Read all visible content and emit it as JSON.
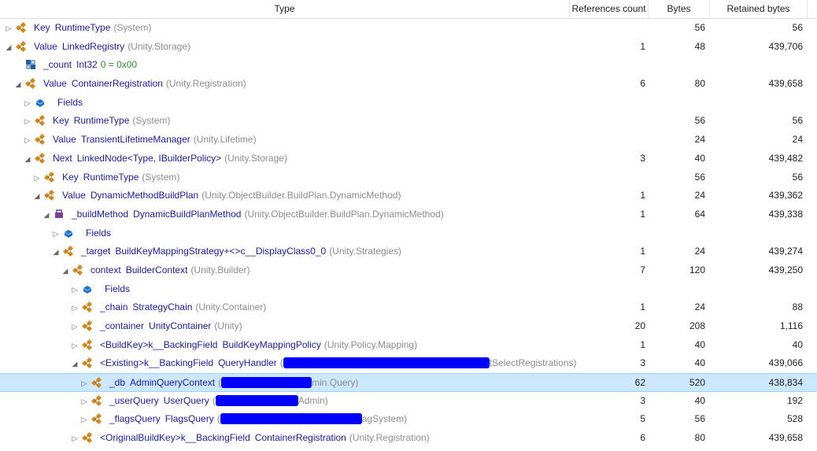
{
  "columns": {
    "type": "Type",
    "refs": "References count",
    "bytes": "Bytes",
    "retained": "Retained bytes"
  },
  "rows": [
    {
      "expand": "▷",
      "indent": 0,
      "icon": "class",
      "name": "Key",
      "type": "RuntimeType",
      "ns": "(System)",
      "refs": "",
      "bytes": "56",
      "retained": "56"
    },
    {
      "expand": "◢",
      "indent": 0,
      "icon": "class",
      "name": "Value",
      "type": "LinkedRegistry",
      "ns": "(Unity.Storage)",
      "refs": "1",
      "bytes": "48",
      "retained": "439,706"
    },
    {
      "expand": "",
      "indent": 1,
      "icon": "field",
      "name": "_count",
      "type": "Int32",
      "value": "0 = 0x00",
      "ns": "",
      "refs": "",
      "bytes": "",
      "retained": ""
    },
    {
      "expand": "◢",
      "indent": 1,
      "icon": "class",
      "name": "Value",
      "type": "ContainerRegistration",
      "ns": "(Unity.Registration)",
      "refs": "6",
      "bytes": "80",
      "retained": "439,658"
    },
    {
      "expand": "▷",
      "indent": 2,
      "icon": "fields",
      "name": "",
      "type": "",
      "fields": "Fields",
      "ns": "",
      "refs": "",
      "bytes": "",
      "retained": ""
    },
    {
      "expand": "▷",
      "indent": 2,
      "icon": "class",
      "name": "Key",
      "type": "RuntimeType",
      "ns": "(System)",
      "refs": "",
      "bytes": "56",
      "retained": "56"
    },
    {
      "expand": "▷",
      "indent": 2,
      "icon": "class",
      "name": "Value",
      "type": "TransientLifetimeManager",
      "ns": "(Unity.Lifetime)",
      "refs": "",
      "bytes": "24",
      "retained": "24"
    },
    {
      "expand": "◢",
      "indent": 2,
      "icon": "class",
      "name": "Next",
      "type": "LinkedNode<Type, IBuilderPolicy>",
      "ns": "(Unity.Storage)",
      "refs": "3",
      "bytes": "40",
      "retained": "439,482"
    },
    {
      "expand": "▷",
      "indent": 3,
      "icon": "class",
      "name": "Key",
      "type": "RuntimeType",
      "ns": "(System)",
      "refs": "",
      "bytes": "56",
      "retained": "56"
    },
    {
      "expand": "◢",
      "indent": 3,
      "icon": "class",
      "name": "Value",
      "type": "DynamicMethodBuildPlan",
      "ns": "(Unity.ObjectBuilder.BuildPlan.DynamicMethod)",
      "refs": "1",
      "bytes": "24",
      "retained": "439,362"
    },
    {
      "expand": "◢",
      "indent": 4,
      "icon": "delegate",
      "name": "_buildMethod",
      "type": "DynamicBuildPlanMethod",
      "ns": "(Unity.ObjectBuilder.BuildPlan.DynamicMethod)",
      "refs": "1",
      "bytes": "64",
      "retained": "439,338"
    },
    {
      "expand": "▷",
      "indent": 5,
      "icon": "fields",
      "name": "",
      "type": "",
      "fields": "Fields",
      "ns": "",
      "refs": "",
      "bytes": "",
      "retained": ""
    },
    {
      "expand": "◢",
      "indent": 5,
      "icon": "class",
      "name": "_target",
      "type": "BuildKeyMappingStrategy+<>c__DisplayClass0_0",
      "ns": "(Unity.Strategies)",
      "refs": "1",
      "bytes": "24",
      "retained": "439,274"
    },
    {
      "expand": "◢",
      "indent": 6,
      "icon": "class",
      "name": "context",
      "type": "BuilderContext",
      "ns": "(Unity.Builder)",
      "refs": "7",
      "bytes": "120",
      "retained": "439,250"
    },
    {
      "expand": "▷",
      "indent": 7,
      "icon": "fields",
      "name": "",
      "type": "",
      "fields": "Fields",
      "ns": "",
      "refs": "",
      "bytes": "",
      "retained": ""
    },
    {
      "expand": "▷",
      "indent": 7,
      "icon": "class",
      "name": "_chain",
      "type": "StrategyChain",
      "ns": "(Unity.Container)",
      "refs": "1",
      "bytes": "24",
      "retained": "88"
    },
    {
      "expand": "▷",
      "indent": 7,
      "icon": "class",
      "name": "_container",
      "type": "UnityContainer",
      "ns": "(Unity)",
      "refs": "20",
      "bytes": "208",
      "retained": "1,116"
    },
    {
      "expand": "▷",
      "indent": 7,
      "icon": "class",
      "name": "<BuildKey>k__BackingField",
      "type": "BuildKeyMappingPolicy",
      "ns": "(Unity.Policy.Mapping)",
      "refs": "1",
      "bytes": "40",
      "retained": "40"
    },
    {
      "expand": "◢",
      "indent": 7,
      "icon": "class",
      "name": "<Existing>k__BackingField",
      "type": "QueryHandler",
      "ns": "(",
      "redact": 262,
      "ns_tail": "tSelectRegistrations)",
      "refs": "3",
      "bytes": "40",
      "retained": "439,066"
    },
    {
      "expand": "▷",
      "indent": 8,
      "icon": "class",
      "name": "_db",
      "type": "AdminQueryContext",
      "ns": "(",
      "redact": 115,
      "ns_tail": "min.Query)",
      "refs": "62",
      "bytes": "520",
      "retained": "438,834",
      "selected": true
    },
    {
      "expand": "▷",
      "indent": 8,
      "icon": "class",
      "name": "_userQuery",
      "type": "UserQuery",
      "ns": "(",
      "redact": 105,
      "ns_tail": "Admin)",
      "refs": "3",
      "bytes": "40",
      "retained": "192"
    },
    {
      "expand": "▷",
      "indent": 8,
      "icon": "class",
      "name": "_flagsQuery",
      "type": "FlagsQuery",
      "ns": "(",
      "redact": 180,
      "ns_tail": "agSystem)",
      "refs": "5",
      "bytes": "56",
      "retained": "528"
    },
    {
      "expand": "▷",
      "indent": 7,
      "icon": "class",
      "name": "<OriginalBuildKey>k__BackingField",
      "type": "ContainerRegistration",
      "ns": "(Unity.Registration)",
      "refs": "6",
      "bytes": "80",
      "retained": "439,658"
    }
  ]
}
